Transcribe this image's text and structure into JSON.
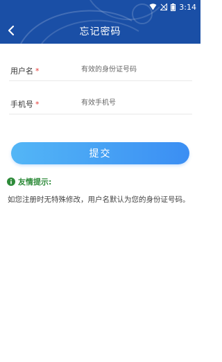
{
  "status_bar": {
    "time": "3:14"
  },
  "nav": {
    "title": "忘记密码"
  },
  "form": {
    "username": {
      "label": "用户名",
      "required_mark": "*",
      "placeholder": "有效的身份证号码"
    },
    "phone": {
      "label": "手机号",
      "required_mark": "*",
      "placeholder": "有效手机号"
    }
  },
  "submit_label": "提交",
  "tip": {
    "title": "友情提示:",
    "text": "如您注册时无特殊修改，用户名默认为您的身份证号码。"
  },
  "colors": {
    "header": "#1a4fa6",
    "button_start": "#53b6f6",
    "button_end": "#3b8ef3",
    "tip": "#2e8b3a",
    "required": "#e53935"
  }
}
